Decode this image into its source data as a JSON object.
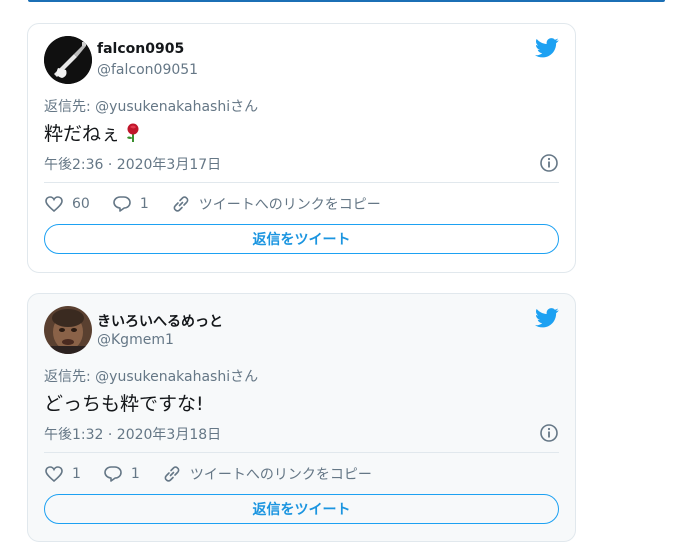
{
  "colors": {
    "accent": "#1da1f2",
    "secondary_text": "#657786",
    "primary_text": "#14171a",
    "border": "#e1e8ed"
  },
  "tweets": [
    {
      "display_name": "falcon0905",
      "handle": "@falcon09051",
      "reply_to": "返信先: @yusukenakahashiさん",
      "text": "粋だねぇ",
      "emoji": "rose",
      "timestamp": "午後2:36 · 2020年3月17日",
      "likes": "60",
      "replies": "1",
      "copy_link": "ツイートへのリンクをコピー",
      "reply_button": "返信をツイート"
    },
    {
      "display_name": "きいろいへるめっと",
      "handle": "@Kgmem1",
      "reply_to": "返信先: @yusukenakahashiさん",
      "text": "どっちも粋ですな!",
      "timestamp": "午後1:32 · 2020年3月18日",
      "likes": "1",
      "replies": "1",
      "copy_link": "ツイートへのリンクをコピー",
      "reply_button": "返信をツイート"
    }
  ]
}
